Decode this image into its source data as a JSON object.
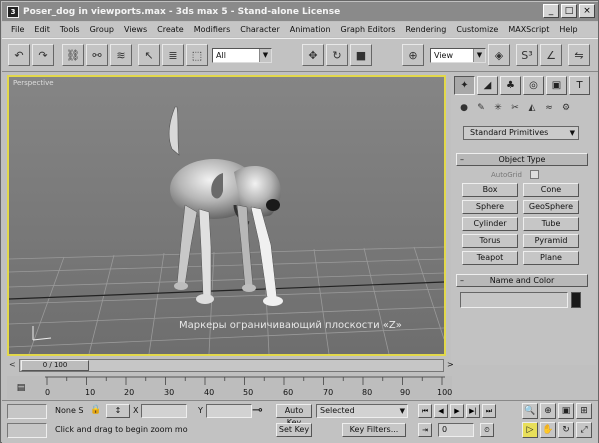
{
  "window": {
    "title": "Poser_dog in viewports.max - 3ds max 5 - Stand-alone License",
    "minimize": "_",
    "maximize": "□",
    "close": "×"
  },
  "menu": [
    "File",
    "Edit",
    "Tools",
    "Group",
    "Views",
    "Create",
    "Modifiers",
    "Character",
    "Animation",
    "Graph Editors",
    "Rendering",
    "Customize",
    "MAXScript",
    "Help"
  ],
  "toolbar": {
    "selection_filter": "All",
    "reference_coord": "View"
  },
  "viewport": {
    "label": "Perspective",
    "caption": "Маркеры ограничивающий плоскости «Z»",
    "axis": "Z"
  },
  "command_panel": {
    "category_dropdown": "Standard Primitives",
    "object_type_title": "Object Type",
    "autogrid_label": "AutoGrid",
    "object_buttons": [
      "Box",
      "Cone",
      "Sphere",
      "GeoSphere",
      "Cylinder",
      "Tube",
      "Torus",
      "Pyramid",
      "Teapot",
      "Plane"
    ],
    "name_color_title": "Name and Color",
    "name_value": ""
  },
  "timeline": {
    "frame_display": "0 / 100",
    "left_arrow": "<",
    "right_arrow": ">",
    "ticks": [
      "0",
      "10",
      "20",
      "30",
      "40",
      "50",
      "60",
      "70",
      "80",
      "90",
      "100"
    ]
  },
  "status": {
    "selection_text": "None S",
    "x_label": "X",
    "y_label": "Y",
    "prompt": "Click and drag to begin zoom mo",
    "auto_key": "Auto Key",
    "set_key": "Set Key",
    "key_mode": "Selected",
    "key_filters": "Key Filters...",
    "frame_field": "0"
  }
}
